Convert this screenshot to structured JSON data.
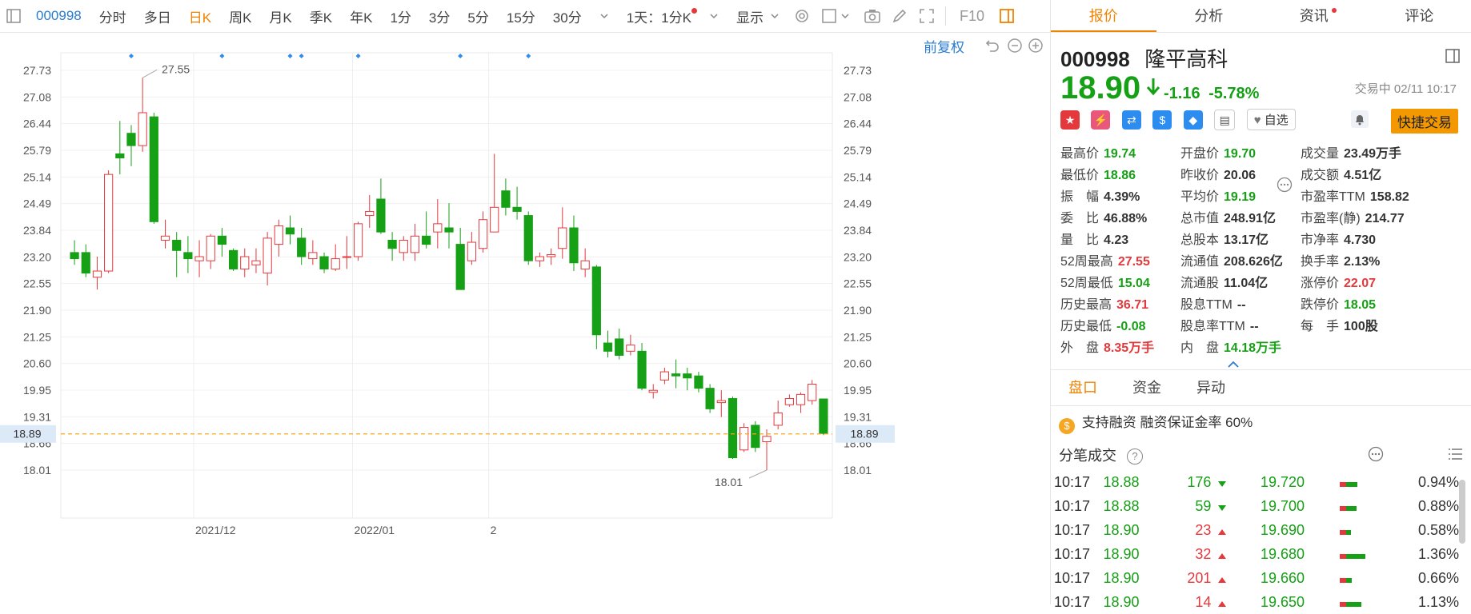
{
  "toolbar": {
    "code": "000998",
    "items": [
      "分时",
      "多日",
      "日K",
      "周K",
      "月K",
      "季K",
      "年K",
      "1分",
      "3分",
      "5分",
      "15分",
      "30分"
    ],
    "active": "日K",
    "period_select": "1天：1分K",
    "display_label": "显示",
    "f10_label": "F10",
    "fq_label": "前复权"
  },
  "colors": {
    "up": "#e4393c",
    "down": "#16a016",
    "accent": "#f08300",
    "price_line": "#f5a623"
  },
  "chart_data": {
    "type": "candlestick",
    "yticks": [
      "27.73",
      "27.08",
      "26.44",
      "25.79",
      "25.14",
      "24.49",
      "23.84",
      "23.20",
      "22.55",
      "21.90",
      "21.25",
      "20.60",
      "19.95",
      "19.31",
      "18.66",
      "18.01"
    ],
    "ylim": [
      17.5,
      28.0
    ],
    "xlabels": [
      {
        "index": 11,
        "label": "2021/12"
      },
      {
        "index": 25,
        "label": "2022/01"
      },
      {
        "index": 37,
        "label": "2"
      }
    ],
    "max_label": "27.55",
    "min_label": "18.01",
    "current_price_label": "18.89",
    "current_price": 18.89,
    "marker_indices": [
      5,
      13,
      19,
      20,
      25,
      34,
      40
    ],
    "candles": [
      {
        "o": 23.3,
        "c": 23.15,
        "h": 23.6,
        "l": 23.0
      },
      {
        "o": 23.3,
        "c": 22.8,
        "h": 23.5,
        "l": 22.7
      },
      {
        "o": 22.7,
        "c": 22.85,
        "h": 23.2,
        "l": 22.4
      },
      {
        "o": 22.85,
        "c": 25.2,
        "h": 25.3,
        "l": 22.8
      },
      {
        "o": 25.7,
        "c": 25.6,
        "h": 26.5,
        "l": 25.2
      },
      {
        "o": 26.2,
        "c": 25.9,
        "h": 26.4,
        "l": 25.4
      },
      {
        "o": 25.9,
        "c": 26.7,
        "h": 27.55,
        "l": 25.75
      },
      {
        "o": 26.6,
        "c": 24.05,
        "h": 26.7,
        "l": 24.0
      },
      {
        "o": 23.6,
        "c": 23.7,
        "h": 24.1,
        "l": 23.4
      },
      {
        "o": 23.6,
        "c": 23.35,
        "h": 23.8,
        "l": 22.7
      },
      {
        "o": 23.3,
        "c": 23.15,
        "h": 23.7,
        "l": 22.8
      },
      {
        "o": 23.1,
        "c": 23.2,
        "h": 23.6,
        "l": 22.7
      },
      {
        "o": 23.1,
        "c": 23.7,
        "h": 23.75,
        "l": 22.9
      },
      {
        "o": 23.7,
        "c": 23.5,
        "h": 23.9,
        "l": 23.2
      },
      {
        "o": 23.35,
        "c": 22.9,
        "h": 23.4,
        "l": 22.85
      },
      {
        "o": 22.9,
        "c": 23.2,
        "h": 23.4,
        "l": 22.7
      },
      {
        "o": 23.0,
        "c": 23.1,
        "h": 23.4,
        "l": 22.8
      },
      {
        "o": 22.8,
        "c": 23.65,
        "h": 23.8,
        "l": 22.5
      },
      {
        "o": 23.5,
        "c": 23.95,
        "h": 24.1,
        "l": 23.2
      },
      {
        "o": 23.9,
        "c": 23.75,
        "h": 24.2,
        "l": 23.5
      },
      {
        "o": 23.65,
        "c": 23.2,
        "h": 23.9,
        "l": 23.0
      },
      {
        "o": 23.15,
        "c": 23.3,
        "h": 23.6,
        "l": 23.0
      },
      {
        "o": 23.2,
        "c": 22.9,
        "h": 23.3,
        "l": 22.8
      },
      {
        "o": 22.9,
        "c": 23.15,
        "h": 23.5,
        "l": 22.85
      },
      {
        "o": 23.2,
        "c": 23.2,
        "h": 23.7,
        "l": 22.9
      },
      {
        "o": 23.2,
        "c": 24.0,
        "h": 24.05,
        "l": 23.1
      },
      {
        "o": 24.2,
        "c": 24.3,
        "h": 24.7,
        "l": 23.9
      },
      {
        "o": 24.6,
        "c": 23.8,
        "h": 25.1,
        "l": 23.75
      },
      {
        "o": 23.6,
        "c": 23.4,
        "h": 23.8,
        "l": 23.1
      },
      {
        "o": 23.3,
        "c": 23.6,
        "h": 23.7,
        "l": 23.1
      },
      {
        "o": 23.3,
        "c": 23.7,
        "h": 24.0,
        "l": 23.1
      },
      {
        "o": 23.7,
        "c": 23.5,
        "h": 24.3,
        "l": 23.4
      },
      {
        "o": 23.8,
        "c": 24.0,
        "h": 24.6,
        "l": 23.4
      },
      {
        "o": 23.9,
        "c": 23.8,
        "h": 24.5,
        "l": 23.4
      },
      {
        "o": 23.5,
        "c": 22.4,
        "h": 23.9,
        "l": 22.4
      },
      {
        "o": 23.1,
        "c": 23.55,
        "h": 23.8,
        "l": 23.0
      },
      {
        "o": 23.4,
        "c": 24.1,
        "h": 24.3,
        "l": 23.3
      },
      {
        "o": 23.8,
        "c": 24.4,
        "h": 25.7,
        "l": 23.8
      },
      {
        "o": 24.8,
        "c": 24.4,
        "h": 25.1,
        "l": 24.2
      },
      {
        "o": 24.4,
        "c": 24.3,
        "h": 24.9,
        "l": 24.1
      },
      {
        "o": 24.2,
        "c": 23.1,
        "h": 24.3,
        "l": 23.0
      },
      {
        "o": 23.1,
        "c": 23.2,
        "h": 23.3,
        "l": 22.95
      },
      {
        "o": 23.2,
        "c": 23.25,
        "h": 23.4,
        "l": 23.0
      },
      {
        "o": 23.4,
        "c": 23.9,
        "h": 24.4,
        "l": 23.15
      },
      {
        "o": 23.9,
        "c": 23.05,
        "h": 24.2,
        "l": 22.85
      },
      {
        "o": 22.9,
        "c": 23.1,
        "h": 23.4,
        "l": 22.7
      },
      {
        "o": 22.95,
        "c": 21.3,
        "h": 23.0,
        "l": 20.95
      },
      {
        "o": 21.1,
        "c": 20.9,
        "h": 21.4,
        "l": 20.75
      },
      {
        "o": 21.2,
        "c": 20.8,
        "h": 21.45,
        "l": 20.7
      },
      {
        "o": 20.9,
        "c": 21.05,
        "h": 21.3,
        "l": 20.8
      },
      {
        "o": 20.9,
        "c": 20.0,
        "h": 21.1,
        "l": 19.95
      },
      {
        "o": 19.9,
        "c": 19.95,
        "h": 20.1,
        "l": 19.75
      },
      {
        "o": 20.2,
        "c": 20.4,
        "h": 20.5,
        "l": 20.1
      },
      {
        "o": 20.35,
        "c": 20.3,
        "h": 20.7,
        "l": 20.0
      },
      {
        "o": 20.35,
        "c": 20.25,
        "h": 20.5,
        "l": 19.95
      },
      {
        "o": 20.3,
        "c": 20.0,
        "h": 20.4,
        "l": 19.9
      },
      {
        "o": 20.0,
        "c": 19.5,
        "h": 20.1,
        "l": 19.4
      },
      {
        "o": 19.65,
        "c": 19.7,
        "h": 19.95,
        "l": 19.3
      },
      {
        "o": 19.75,
        "c": 18.31,
        "h": 19.8,
        "l": 18.28
      },
      {
        "o": 18.5,
        "c": 19.05,
        "h": 19.15,
        "l": 18.45
      },
      {
        "o": 19.1,
        "c": 18.56,
        "h": 19.2,
        "l": 18.45
      },
      {
        "o": 18.7,
        "c": 18.83,
        "h": 19.0,
        "l": 18.01
      },
      {
        "o": 19.1,
        "c": 19.4,
        "h": 19.7,
        "l": 19.0
      },
      {
        "o": 19.6,
        "c": 19.75,
        "h": 19.85,
        "l": 19.55
      },
      {
        "o": 19.6,
        "c": 19.85,
        "h": 19.9,
        "l": 19.4
      },
      {
        "o": 19.7,
        "c": 20.1,
        "h": 20.2,
        "l": 19.6
      },
      {
        "o": 19.74,
        "c": 18.9,
        "h": 19.74,
        "l": 18.86
      }
    ]
  },
  "right": {
    "tabs": [
      "报价",
      "分析",
      "资讯",
      "评论"
    ],
    "code": "000998",
    "name": "隆平高科",
    "price": "18.90",
    "change": "-1.16",
    "change_pct": "-5.78%",
    "status": "交易中 02/11 10:17",
    "fav_label": "自选",
    "quick_label": "快捷交易",
    "stats": [
      [
        [
          "最高价",
          "19.74",
          "dn"
        ],
        [
          "开盘价",
          "19.70",
          "dn"
        ],
        [
          "成交量",
          "23.49万手",
          "nm"
        ]
      ],
      [
        [
          "最低价",
          "18.86",
          "dn"
        ],
        [
          "昨收价",
          "20.06",
          "nm"
        ],
        [
          "成交额",
          "4.51亿",
          "nm"
        ]
      ],
      [
        [
          "振　幅",
          "4.39%",
          "nm"
        ],
        [
          "平均价",
          "19.19",
          "dn"
        ],
        [
          "市盈率TTM",
          "158.82",
          "nm"
        ]
      ],
      [
        [
          "委　比",
          "46.88%",
          "nm"
        ],
        [
          "总市值",
          "248.91亿",
          "nm"
        ],
        [
          "市盈率(静)",
          "214.77",
          "nm"
        ]
      ],
      [
        [
          "量　比",
          "4.23",
          "nm"
        ],
        [
          "总股本",
          "13.17亿",
          "nm"
        ],
        [
          "市净率",
          "4.730",
          "nm"
        ]
      ],
      [
        [
          "52周最高",
          "27.55",
          "up"
        ],
        [
          "流通值",
          "208.626亿",
          "nm"
        ],
        [
          "换手率",
          "2.13%",
          "nm"
        ]
      ],
      [
        [
          "52周最低",
          "15.04",
          "dn"
        ],
        [
          "流通股",
          "11.04亿",
          "nm"
        ],
        [
          "涨停价",
          "22.07",
          "up"
        ]
      ],
      [
        [
          "历史最高",
          "36.71",
          "up"
        ],
        [
          "股息TTM",
          "--",
          "nm"
        ],
        [
          "跌停价",
          "18.05",
          "dn"
        ]
      ],
      [
        [
          "历史最低",
          "-0.08",
          "dn"
        ],
        [
          "股息率TTM",
          "--",
          "nm"
        ],
        [
          "每　手",
          "100股",
          "nm"
        ]
      ],
      [
        [
          "外　盘",
          "8.35万手",
          "up"
        ],
        [
          "内　盘",
          "14.18万手",
          "dn"
        ],
        [
          "",
          "",
          " nm"
        ]
      ]
    ],
    "subtabs": [
      "盘口",
      "资金",
      "异动"
    ],
    "margin_text": "支持融资 融资保证金率 60%",
    "tick_title": "分笔成交",
    "ticks": [
      {
        "time": "10:17",
        "price": "18.88",
        "vol": "176",
        "dir": "dn",
        "ref": "19.720",
        "bar": 0.32,
        "pct": "0.94%"
      },
      {
        "time": "10:17",
        "price": "18.88",
        "vol": "59",
        "dir": "dn",
        "ref": "19.700",
        "bar": 0.3,
        "pct": "0.88%"
      },
      {
        "time": "10:17",
        "price": "18.90",
        "vol": "23",
        "dir": "up",
        "ref": "19.690",
        "bar": 0.2,
        "pct": "0.58%"
      },
      {
        "time": "10:17",
        "price": "18.90",
        "vol": "32",
        "dir": "up",
        "ref": "19.680",
        "bar": 0.46,
        "pct": "1.36%"
      },
      {
        "time": "10:17",
        "price": "18.90",
        "vol": "201",
        "dir": "up",
        "ref": "19.660",
        "bar": 0.22,
        "pct": "0.66%"
      },
      {
        "time": "10:17",
        "price": "18.90",
        "vol": "14",
        "dir": "up",
        "ref": "19.650",
        "bar": 0.38,
        "pct": "1.13%"
      }
    ]
  }
}
